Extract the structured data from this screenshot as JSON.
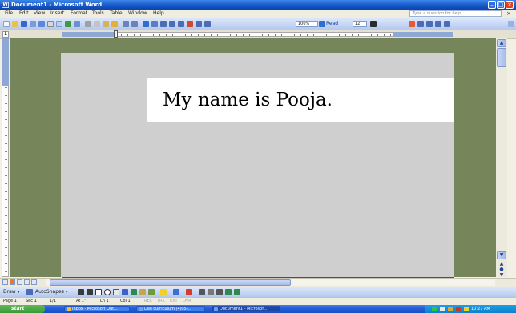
{
  "window": {
    "title": "Document1 - Microsoft Word"
  },
  "menu": {
    "items": [
      "File",
      "Edit",
      "View",
      "Insert",
      "Format",
      "Tools",
      "Table",
      "Window",
      "Help"
    ],
    "help_placeholder": "Type a question for help",
    "close_glyph": "×"
  },
  "toolbar": {
    "zoom": "100%",
    "read_label": "Read",
    "font_size": "12"
  },
  "document": {
    "text": "My name is Pooja."
  },
  "drawing_toolbar": {
    "draw_label": "Draw ▾",
    "autoshapes_label": "AutoShapes ▾"
  },
  "statusbar": {
    "page": "Page 1",
    "section": "Sec 1",
    "page_of": "1/1",
    "at": "At 1\"",
    "line": "Ln 1",
    "col": "Col 1",
    "rec": "REC",
    "trk": "TRK",
    "ext": "EXT",
    "ovr": "OVR"
  },
  "taskbar": {
    "start": "start",
    "buttons": [
      "Inbox - Microsoft Out...",
      "Dell curriculum (4/05)...",
      "Document1 - Microsof..."
    ],
    "clock": "10:27 AM"
  },
  "colors": {
    "titlebar": "#1456c9",
    "document_background": "#77855a",
    "page": "#cfcfcf",
    "taskbar": "#245edb",
    "start": "#3a9a36"
  }
}
